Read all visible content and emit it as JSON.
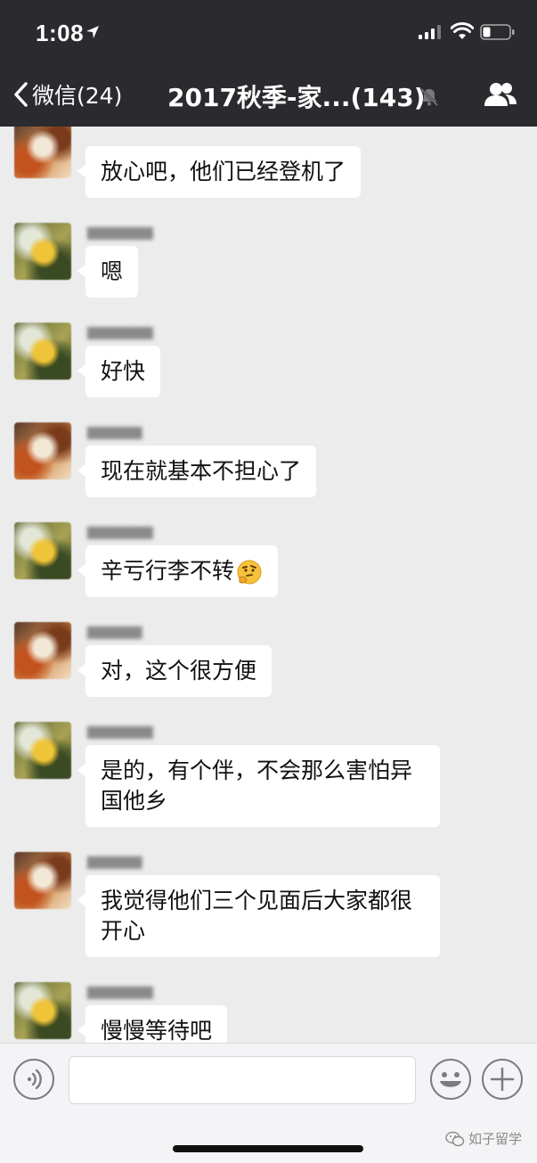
{
  "status_bar": {
    "time": "1:08",
    "icons": [
      "location-arrow-icon",
      "signal-icon",
      "wifi-icon",
      "battery-icon"
    ]
  },
  "nav": {
    "back_label": "微信(24)",
    "title": "2017秋季-家...(143)",
    "icons": [
      "chevron-left-icon",
      "mute-icon",
      "members-icon"
    ]
  },
  "messages": [
    {
      "avatar": "a2",
      "text": "放心吧，他们已经登机了"
    },
    {
      "avatar": "a1",
      "text": "嗯"
    },
    {
      "avatar": "a1",
      "text": "好快"
    },
    {
      "avatar": "a2",
      "text": "现在就基本不担心了"
    },
    {
      "avatar": "a1",
      "text": "辛亏行李不转",
      "emoji": "thinking-face"
    },
    {
      "avatar": "a2",
      "text": "对，这个很方便"
    },
    {
      "avatar": "a1",
      "text": "是的，有个伴，不会那么害怕异国他乡"
    },
    {
      "avatar": "a2",
      "text": "我觉得他们三个见面后大家都很开心"
    },
    {
      "avatar": "a1",
      "text": "慢慢等待吧"
    }
  ],
  "input_bar": {
    "icons": [
      "voice-icon",
      "emoji-icon",
      "plus-icon"
    ]
  },
  "watermark": "如子留学",
  "colors": {
    "nav_background": "#2b2b2f",
    "chat_background": "#ececec",
    "bubble": "#ffffff"
  }
}
